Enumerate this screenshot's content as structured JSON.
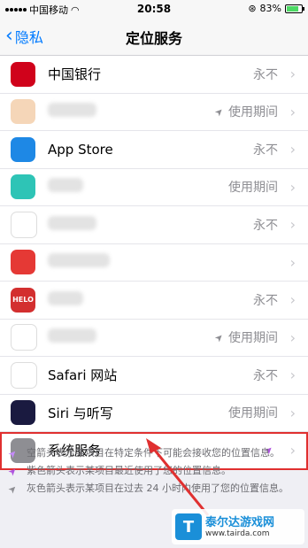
{
  "status": {
    "carrier": "中国移动",
    "time": "20:58",
    "battery": "83%"
  },
  "nav": {
    "back_label": "隐私",
    "title": "定位服务"
  },
  "rows": [
    {
      "label": "中国银行",
      "value": "永不",
      "icon_color": "#d0021b"
    },
    {
      "label": "",
      "value": "使用期间",
      "icon_color": "#f5d6b8",
      "arrow": "gray"
    },
    {
      "label": "App Store",
      "value": "永不",
      "icon_color": "#1e88e5"
    },
    {
      "label": "",
      "value": "使用期间",
      "icon_color": "#2ec4b6"
    },
    {
      "label": "",
      "value": "永不",
      "icon_color": "#ffffff"
    },
    {
      "label": "",
      "value": "",
      "icon_color": "#e53935"
    },
    {
      "label": "",
      "value": "永不",
      "icon_color": "#d32f2f",
      "icon_text": "HELO"
    },
    {
      "label": "",
      "value": "使用期间",
      "icon_color": "#ffffff",
      "arrow": "gray"
    },
    {
      "label": "Safari 网站",
      "value": "永不",
      "icon_color": "#ffffff"
    },
    {
      "label": "Siri 与听写",
      "value": "使用期间",
      "icon_color": "#1a1a40"
    },
    {
      "label": "系统服务",
      "value": "",
      "icon_color": "#8e8e93",
      "arrow": "purple"
    }
  ],
  "notes": [
    {
      "text": "空箭头表示某项目在特定条件下可能会接收您的位置信息。",
      "arrow_color": "#c58af9"
    },
    {
      "text": "紫色箭头表示某项目最近使用了您的位置信息。",
      "arrow_color": "#af52de"
    },
    {
      "text": "灰色箭头表示某项目在过去 24 小时内使用了您的位置信息。",
      "arrow_color": "#8e8e93"
    }
  ],
  "watermark": {
    "name": "泰尔达游戏网",
    "url": "www.tairda.com"
  },
  "colors": {
    "accent": "#007aff",
    "highlight": "#e03030"
  }
}
